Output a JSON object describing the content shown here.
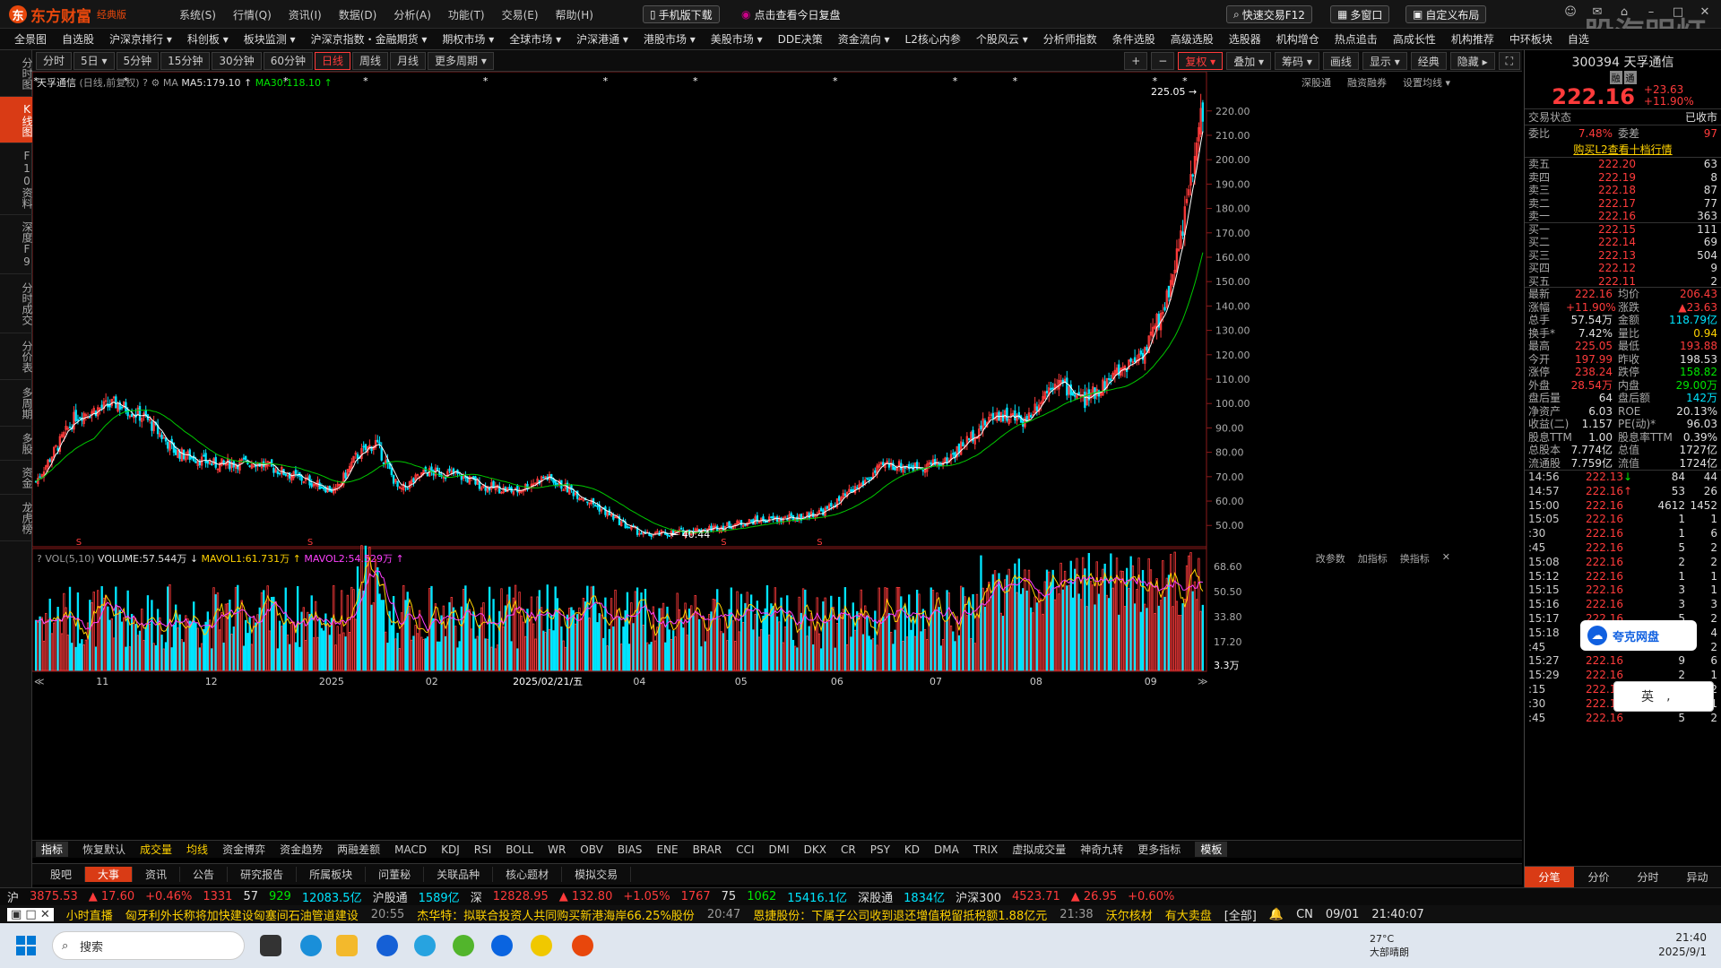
{
  "app": {
    "logo_text": "东方财富",
    "edition": "经典版",
    "watermark": "股海明灯"
  },
  "menu": [
    "系统(S)",
    "行情(Q)",
    "资讯(I)",
    "数据(D)",
    "分析(A)",
    "功能(T)",
    "交易(E)",
    "帮助(H)"
  ],
  "top_buttons": {
    "mobile": "手机版下载",
    "review": "点击查看今日复盘",
    "quick_trade": "快速交易F12",
    "multi_window": "多窗口",
    "custom_layout": "自定义布局"
  },
  "nav": [
    "全景图",
    "自选股",
    "沪深京排行 ▾",
    "科创板 ▾",
    "板块监测 ▾",
    "沪深京指数・金融期货 ▾",
    "期权市场 ▾",
    "全球市场 ▾",
    "沪深港通 ▾",
    "港股市场 ▾",
    "美股市场 ▾",
    "DDE决策",
    "资金流向 ▾",
    "L2核心内参",
    "个股风云 ▾",
    "分析师指数",
    "条件选股",
    "高级选股",
    "选股器",
    "机构增仓",
    "热点追击",
    "高成长性",
    "机构推荐",
    "中环板块",
    "自选"
  ],
  "left_tabs": [
    "分时图",
    "K线图",
    "F10资料",
    "深度F9",
    "分时成交",
    "分价表",
    "多周期",
    "多股",
    "资金",
    "龙虎榜"
  ],
  "periods": [
    "分时",
    "5日 ▾",
    "5分钟",
    "15分钟",
    "30分钟",
    "60分钟",
    "日线",
    "周线",
    "月线",
    "更多周期 ▾"
  ],
  "active_period": "日线",
  "chart_tools": [
    "复权 ▾",
    "叠加 ▾",
    "筹码 ▾",
    "画线",
    "显示 ▾",
    "经典",
    "隐藏 ▸"
  ],
  "chart_data": {
    "type": "candlestick",
    "stock_name": "天孚通信",
    "mode": "(日线,前复权)",
    "ma_legend": {
      "label": "MA",
      "ma5": "MA5:179.10",
      "ma30": "MA30:118.10"
    },
    "right_links": [
      "深股通",
      "融资融券",
      "设置均线 ▾"
    ],
    "y_ticks": [
      50,
      60,
      70,
      80,
      90,
      100,
      110,
      120,
      130,
      140,
      150,
      160,
      170,
      180,
      190,
      200,
      210,
      220
    ],
    "ylim": [
      42,
      228
    ],
    "high_label": "225.05",
    "low_label": "40.44",
    "x_labels": [
      "11",
      "12",
      "2025",
      "02",
      "2025/02/21/五",
      "04",
      "05",
      "06",
      "07",
      "08",
      "09"
    ],
    "vol": {
      "legend": "VOL(5,10)",
      "volume": "VOLUME:57.544万",
      "mavol1": "MAVOL1:61.731万",
      "mavol2": "MAVOL2:54.529万",
      "ticks": [
        "68.60",
        "50.50",
        "33.80",
        "17.20",
        "3.3万"
      ],
      "right_links": [
        "改参数",
        "加指标",
        "换指标"
      ]
    },
    "colors": {
      "up": "#ff3b3b",
      "down": "#00e5ff",
      "ma5": "#ffffff",
      "ma30": "#00c800",
      "mavol1": "#ffd200",
      "mavol2": "#ff40ff"
    }
  },
  "indicator_tabs": [
    "指标",
    "恢复默认",
    "成交量",
    "均线",
    "资金博弈",
    "资金趋势",
    "两融差额",
    "MACD",
    "KDJ",
    "RSI",
    "BOLL",
    "WR",
    "OBV",
    "BIAS",
    "ENE",
    "BRAR",
    "CCI",
    "DMI",
    "DKX",
    "CR",
    "PSY",
    "KD",
    "DMA",
    "TRIX",
    "虚拟成交量",
    "神奇九转",
    "更多指标",
    "模板"
  ],
  "news_tabs": [
    "股吧",
    "大事",
    "资讯",
    "公告",
    "研究报告",
    "所属板块",
    "问董秘",
    "关联品种",
    "核心题材",
    "模拟交易"
  ],
  "right_panel": {
    "code": "300394",
    "name": "天孚通信",
    "tags": [
      "融",
      "通"
    ],
    "price": "222.16",
    "change": "+23.63",
    "pct": "+11.90%",
    "status_label": "交易状态",
    "status_value": "已收市",
    "weibi_label": "委比",
    "weibi": "7.48%",
    "weicha_label": "委差",
    "weicha": "97",
    "l2_link": "购买L2查看十档行情",
    "asks": [
      {
        "l": "卖五",
        "p": "222.20",
        "v": "63"
      },
      {
        "l": "卖四",
        "p": "222.19",
        "v": "8"
      },
      {
        "l": "卖三",
        "p": "222.18",
        "v": "87"
      },
      {
        "l": "卖二",
        "p": "222.17",
        "v": "77"
      },
      {
        "l": "卖一",
        "p": "222.16",
        "v": "363"
      }
    ],
    "bids": [
      {
        "l": "买一",
        "p": "222.15",
        "v": "111"
      },
      {
        "l": "买二",
        "p": "222.14",
        "v": "69"
      },
      {
        "l": "买三",
        "p": "222.13",
        "v": "504"
      },
      {
        "l": "买四",
        "p": "222.12",
        "v": "9"
      },
      {
        "l": "买五",
        "p": "222.11",
        "v": "2"
      }
    ],
    "stats": [
      {
        "a": "最新",
        "b": "222.16",
        "bc": "r",
        "c": "均价",
        "d": "206.43",
        "dc": "r"
      },
      {
        "a": "涨幅",
        "b": "+11.90%",
        "bc": "r",
        "c": "涨跌",
        "d": "▲23.63",
        "dc": "r"
      },
      {
        "a": "总手",
        "b": "57.54万",
        "bc": "w",
        "c": "金额",
        "d": "118.79亿",
        "dc": "c"
      },
      {
        "a": "换手*",
        "b": "7.42%",
        "bc": "w",
        "c": "量比",
        "d": "0.94",
        "dc": "y"
      },
      {
        "a": "最高",
        "b": "225.05",
        "bc": "r",
        "c": "最低",
        "d": "193.88",
        "dc": "r"
      },
      {
        "a": "今开",
        "b": "197.99",
        "bc": "r",
        "c": "昨收",
        "d": "198.53",
        "dc": "w"
      },
      {
        "a": "涨停",
        "b": "238.24",
        "bc": "r",
        "c": "跌停",
        "d": "158.82",
        "dc": "g"
      },
      {
        "a": "外盘",
        "b": "28.54万",
        "bc": "r",
        "c": "内盘",
        "d": "29.00万",
        "dc": "g"
      },
      {
        "a": "盘后量",
        "b": "64",
        "bc": "w",
        "c": "盘后额",
        "d": "142万",
        "dc": "c"
      },
      {
        "a": "净资产",
        "b": "6.03",
        "bc": "w",
        "c": "ROE",
        "d": "20.13%",
        "dc": "w"
      },
      {
        "a": "收益(二)",
        "b": "1.157",
        "bc": "w",
        "c": "PE(动)*",
        "d": "96.03",
        "dc": "w"
      },
      {
        "a": "股息TTM",
        "b": "1.00",
        "bc": "w",
        "c": "股息率TTM",
        "d": "0.39%",
        "dc": "w"
      },
      {
        "a": "总股本",
        "b": "7.774亿",
        "bc": "w",
        "c": "总值",
        "d": "1727亿",
        "dc": "w"
      },
      {
        "a": "流通股",
        "b": "7.759亿",
        "bc": "w",
        "c": "流值",
        "d": "1724亿",
        "dc": "w"
      }
    ],
    "ticks": [
      {
        "t": "14:56",
        "p": "222.13",
        "ar": "↓",
        "v": "84",
        "n": "44",
        "vc": "g"
      },
      {
        "t": "14:57",
        "p": "222.16",
        "ar": "↑",
        "v": "53",
        "n": "26",
        "vc": "r"
      },
      {
        "t": "15:00",
        "p": "222.16",
        "ar": "",
        "v": "4612",
        "n": "1452",
        "vc": "w"
      },
      {
        "t": "15:05",
        "p": "222.16",
        "ar": "",
        "v": "1",
        "n": "1",
        "vc": "r"
      },
      {
        "t": ":30",
        "p": "222.16",
        "ar": "",
        "v": "1",
        "n": "6",
        "vc": "r"
      },
      {
        "t": ":45",
        "p": "222.16",
        "ar": "",
        "v": "5",
        "n": "2",
        "vc": "r"
      },
      {
        "t": "15:08",
        "p": "222.16",
        "ar": "",
        "v": "2",
        "n": "2",
        "vc": "r"
      },
      {
        "t": "15:12",
        "p": "222.16",
        "ar": "",
        "v": "1",
        "n": "1",
        "vc": "r"
      },
      {
        "t": "15:15",
        "p": "222.16",
        "ar": "",
        "v": "3",
        "n": "1",
        "vc": "r"
      },
      {
        "t": "15:16",
        "p": "222.16",
        "ar": "",
        "v": "3",
        "n": "3",
        "vc": "r"
      },
      {
        "t": "15:17",
        "p": "222.16",
        "ar": "",
        "v": "5",
        "n": "2",
        "vc": "r"
      },
      {
        "t": "15:18",
        "p": "222.16",
        "ar": "",
        "v": "2",
        "n": "4",
        "vc": "r"
      },
      {
        "t": ":45",
        "p": "222.16",
        "ar": "",
        "v": "10",
        "n": "2",
        "vc": "r"
      },
      {
        "t": "15:27",
        "p": "222.16",
        "ar": "",
        "v": "9",
        "n": "6",
        "vc": "r"
      },
      {
        "t": "15:29",
        "p": "222.16",
        "ar": "",
        "v": "2",
        "n": "1",
        "vc": "r"
      },
      {
        "t": ":15",
        "p": "222.16",
        "ar": "",
        "v": "3",
        "n": "2",
        "vc": "r"
      },
      {
        "t": ":30",
        "p": "222.16",
        "ar": "",
        "v": "3",
        "n": "1",
        "vc": "r"
      },
      {
        "t": ":45",
        "p": "222.16",
        "ar": "",
        "v": "5",
        "n": "2",
        "vc": "r"
      }
    ],
    "tabs": [
      "分笔",
      "分价",
      "分时",
      "异动"
    ]
  },
  "quote_bar": {
    "a": "沪",
    "b": "3875.53",
    "c": "▲ 17.60",
    "d": "+0.46%",
    "e": "1331",
    "f": "57",
    "g": "929",
    "h": "12083.5亿",
    "i": "沪股通",
    "j": "1589亿",
    "k": "深",
    "l": "12828.95",
    "m": "▲ 132.80",
    "n": "+1.05%",
    "o": "1767",
    "p": "75",
    "q": "1062",
    "r": "15416.1亿",
    "s": "深股通",
    "t": "1834亿",
    "u": "沪深300",
    "v": "4523.71",
    "w": "▲ 26.95",
    "x": "+0.60%"
  },
  "news_bar": {
    "tag": "小时直播",
    "n1": "匈牙利外长称将加快建设匈塞间石油管道建设",
    "t2": "20:55",
    "n2": "杰华特：拟联合投资人共同购买新港海岸66.25%股份",
    "t3": "20:47",
    "n3": "恩捷股份：下属子公司收到退还增值税留抵税额1.88亿元",
    "t4": "21:38",
    "n4": "沃尔核材",
    "n5": "有大卖盘",
    "n6": "[全部]",
    "cn": "CN",
    "date": "09/01",
    "time": "21:40:07"
  },
  "floating": {
    "cloud": "夸克网盘",
    "ime": "英"
  },
  "taskbar": {
    "search": "搜索",
    "weather_temp": "27°C",
    "weather_desc": "大部晴朗",
    "clock_time": "21:40",
    "clock_date": "2025/9/1"
  }
}
